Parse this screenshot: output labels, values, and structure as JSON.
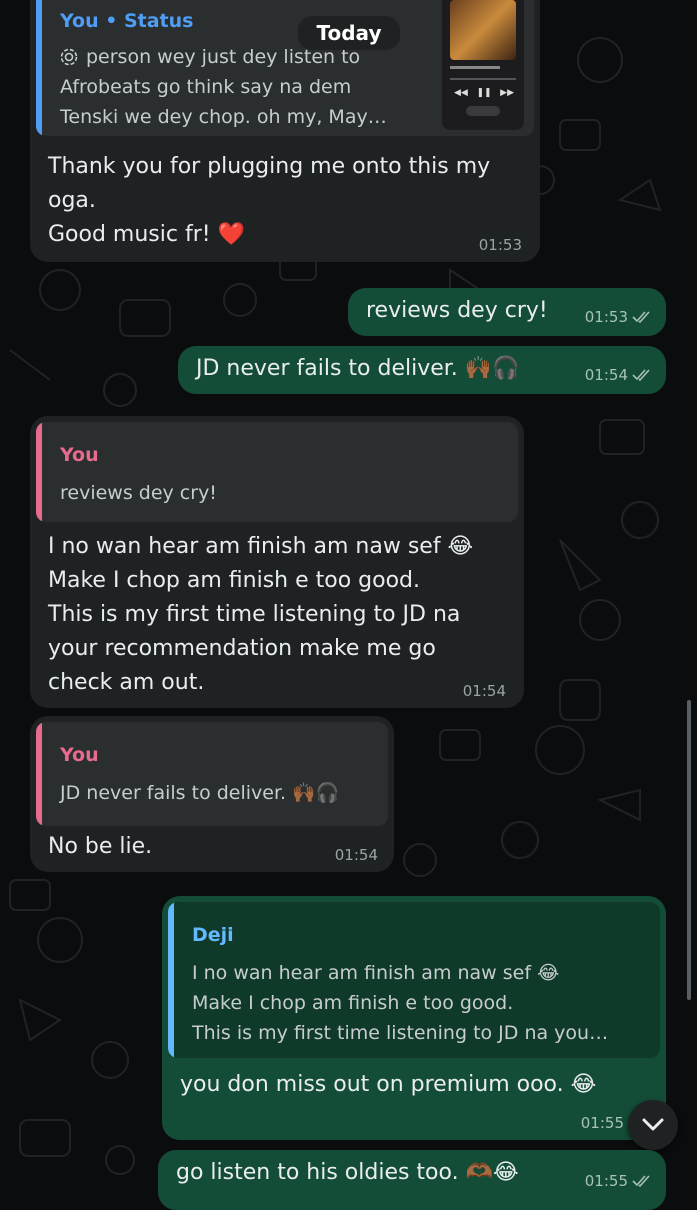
{
  "date_chip": "Today",
  "colors": {
    "incoming_bubble": "#1f2223",
    "outgoing_bubble": "#144d37",
    "reply_author_you": "#e86b8e",
    "reply_author_status": "#4f9df5",
    "reply_author_deji": "#63b8ff"
  },
  "messages": [
    {
      "id": "m1",
      "direction": "in",
      "reply": {
        "author": "You • Status",
        "text": "person wey just dey listen to\nAfrobeats go think say na dem\nTenski we dey chop. oh my, May…",
        "icon": "status-ring-icon",
        "thumbnail": "music-player-thumbnail"
      },
      "text": "Thank you for plugging me onto this my oga.\nGood music fr! ❤️",
      "time": "01:53"
    },
    {
      "id": "m2",
      "direction": "out",
      "text": "reviews dey cry!",
      "time": "01:53",
      "ticks": "double-check-icon"
    },
    {
      "id": "m3",
      "direction": "out",
      "text": "JD never fails to deliver. 🙌🏾🎧",
      "time": "01:54",
      "ticks": "double-check-icon"
    },
    {
      "id": "m4",
      "direction": "in",
      "reply": {
        "author": "You",
        "text": "reviews dey cry!"
      },
      "text": "I no wan hear am finish am naw sef 😂\nMake I chop am finish e too good.\nThis is my first time listening to JD na\nyour recommendation make me go\ncheck am out.",
      "time": "01:54"
    },
    {
      "id": "m5",
      "direction": "in",
      "reply": {
        "author": "You",
        "text": "JD never fails to deliver. 🙌🏾🎧"
      },
      "text": "No be lie.",
      "time": "01:54"
    },
    {
      "id": "m6",
      "direction": "out",
      "reply": {
        "author": "Deji",
        "text": "I no wan hear am finish am naw sef 😂\nMake I chop am finish e too good.\nThis is my first time listening to JD na you…"
      },
      "text": "you don miss out on premium ooo. 😂",
      "time": "01:55"
    },
    {
      "id": "m7",
      "direction": "out",
      "text": "go listen to his oldies too. 🫶🏾😂",
      "time": "01:55",
      "ticks": "double-check-icon"
    }
  ],
  "scroll_down": {
    "icon": "chevron-down-icon"
  }
}
